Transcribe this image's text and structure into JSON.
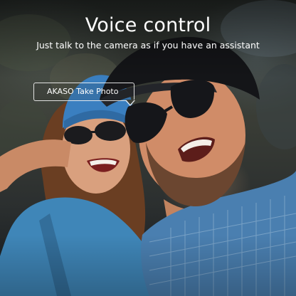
{
  "heading": {
    "title": "Voice control",
    "subtitle": "Just talk to the camera as if you have an assistant"
  },
  "voice_command": {
    "text": "AKASO Take Photo"
  },
  "photo": {
    "description_icon": "people-selfie-photo"
  },
  "colors": {
    "text": "#ffffff",
    "shirt_blue": "#3f86b8",
    "beanie_blue": "#3a7fc0"
  }
}
